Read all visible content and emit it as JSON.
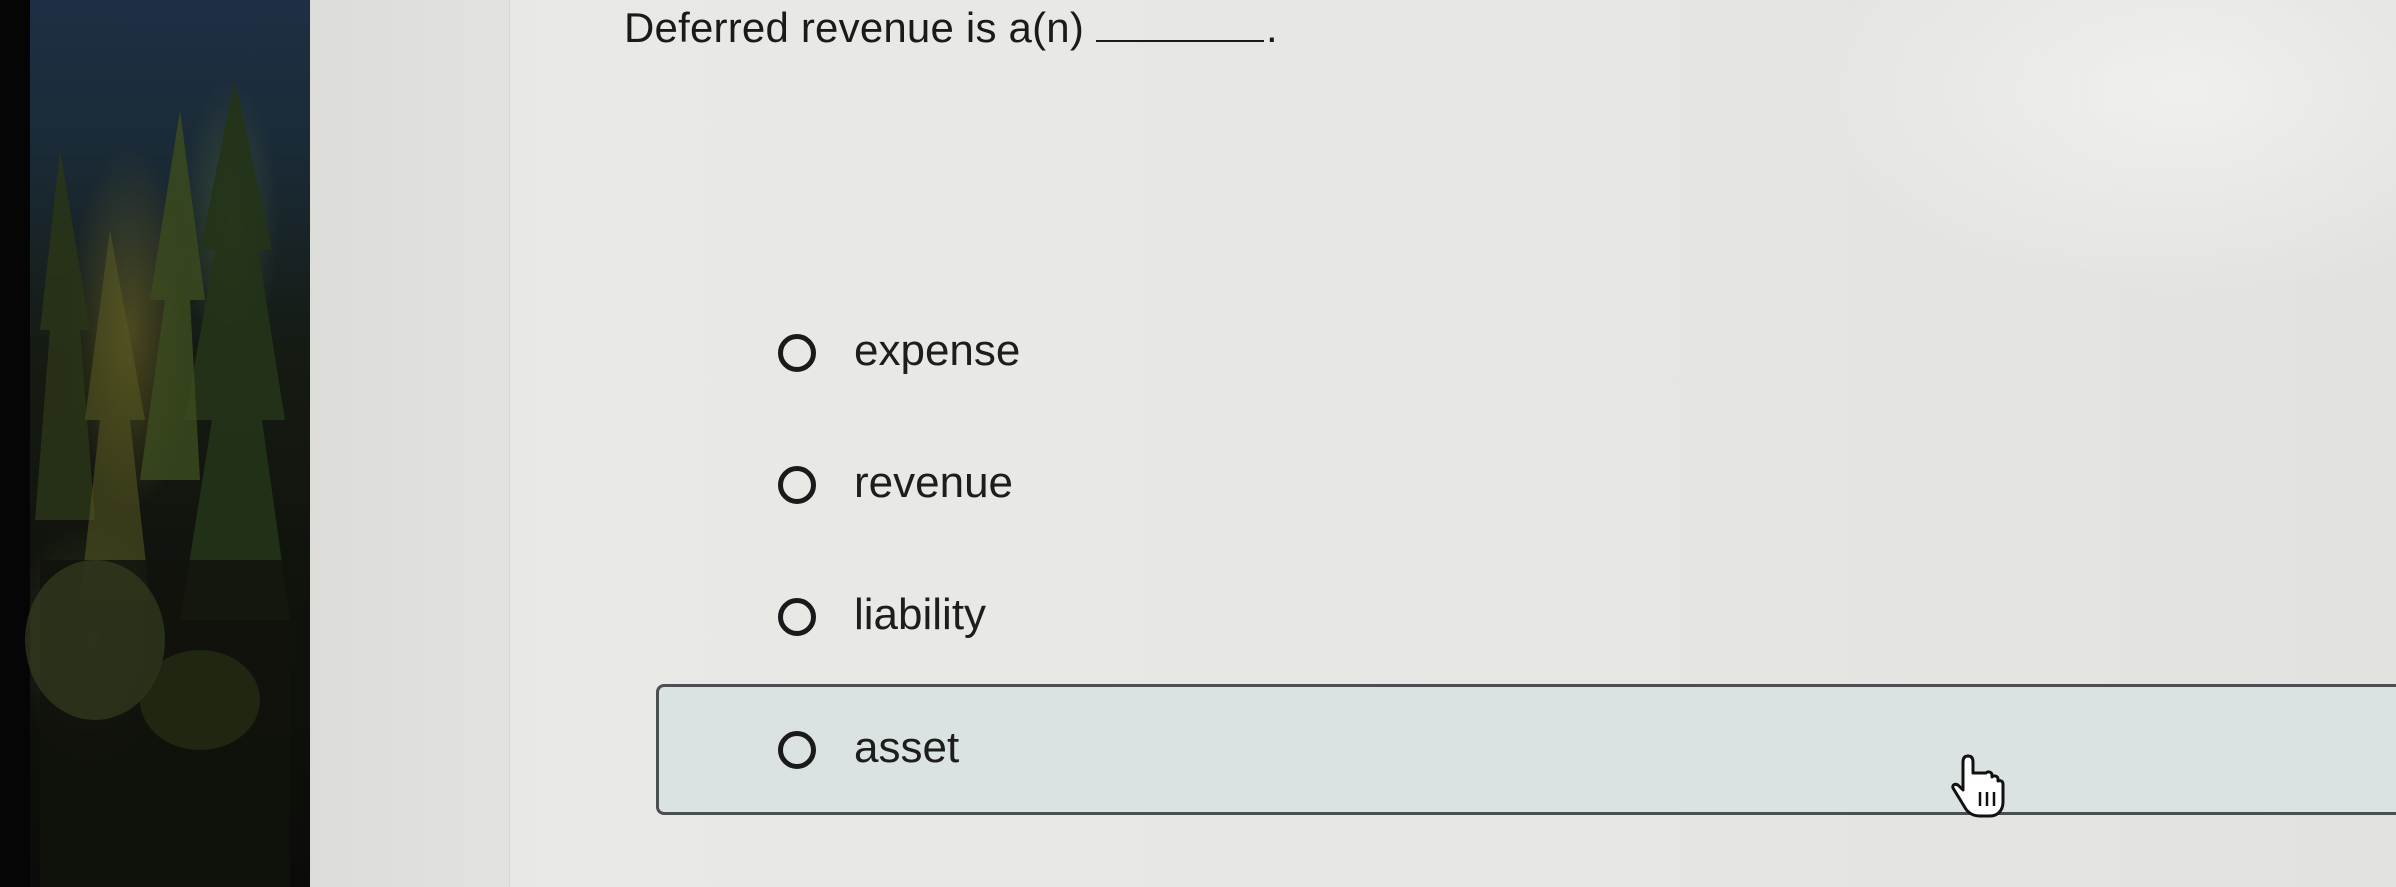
{
  "question": {
    "text": "Deferred revenue is a(n)",
    "period": "."
  },
  "options": [
    {
      "label": "expense",
      "selected": false
    },
    {
      "label": "revenue",
      "selected": false
    },
    {
      "label": "liability",
      "selected": false
    },
    {
      "label": "asset",
      "selected": false,
      "hovered": true
    }
  ],
  "colors": {
    "page_background": "#e6e6e3",
    "text": "#1a1a1a",
    "hover_background": "#dbe3e2",
    "hover_border": "#4c4f52"
  },
  "icons": {
    "cursor": "hand-pointer-icon",
    "radio": "radio-unchecked-icon"
  }
}
